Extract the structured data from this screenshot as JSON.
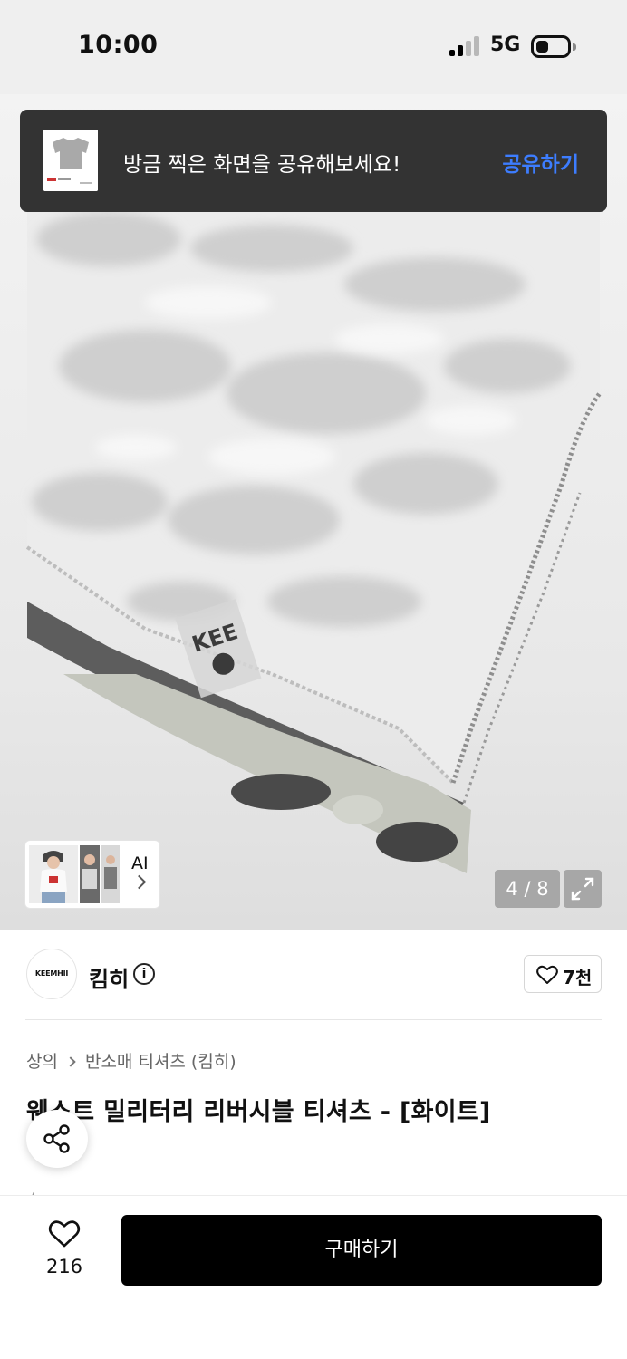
{
  "status_bar": {
    "time": "10:00",
    "network": "5G"
  },
  "toast": {
    "message": "방금 찍은 화면을 공유해보세요!",
    "action": "공유하기"
  },
  "gallery": {
    "ai_label": "AI",
    "counter": "4 / 8"
  },
  "brand": {
    "logo_text": "KEEMHII",
    "name": "킴히",
    "likes": "7천"
  },
  "breadcrumb": {
    "category": "상의",
    "subcategory": "반소매 티셔츠 (킴히)"
  },
  "product": {
    "title": "웨스트 밀리터리 리버시블 티셔츠 - [화이트]"
  },
  "bottom_bar": {
    "wish_count": "216",
    "buy_label": "구매하기"
  },
  "colors": {
    "toast_bg": "#333333",
    "toast_action": "#3d7dff",
    "buy_bg": "#000000"
  }
}
